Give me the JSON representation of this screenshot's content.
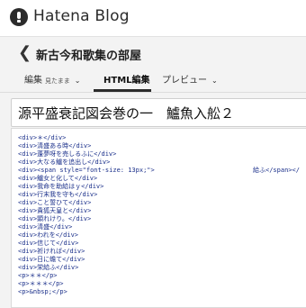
{
  "brand": {
    "name": "Hatena Blog",
    "icon": "hatena-logo-icon"
  },
  "blog": {
    "back_icon": "back-arrow-icon",
    "back_glyph": "❮",
    "title": "新古今和歌集の部屋"
  },
  "tabs": {
    "edit_label": "編集",
    "edit_sub": "見たまま",
    "html_label": "HTML編集",
    "preview_label": "プレビュー",
    "chevron": "⌄"
  },
  "entry": {
    "title": "源平盛衰記図会巻の一　鱸魚入舩２"
  },
  "editor": {
    "lines": [
      "<div>＊</div>",
      "<div>清盛ある時</div>",
      "<div>蓬夢呀を売しるふに</div>",
      "<div>大なる鱸を追出し</div>",
      "<div><span style=\"font-size: 13px;\">",
      "<div>鱸女と化して</div>",
      "<div>我命を助給はｙ</div>",
      "<div>行末我を守も</div>",
      "<div>こと誓ひて</div>",
      "<div>貴狐天皇と</div>",
      "<div>顕れけり。</div>",
      "<div>清盛</div>",
      "<div>われを</div>",
      "<div>信じて</div>",
      "<div>祈ければ</div>",
      "<div>日に蟾て</div>",
      "<div>栄給ふ</div>",
      "<p>＊＊</p>",
      "<p>＊＊＊</p>",
      "<p>&nbsp;</p>"
    ],
    "line4_tail": "給ふ</span></"
  }
}
